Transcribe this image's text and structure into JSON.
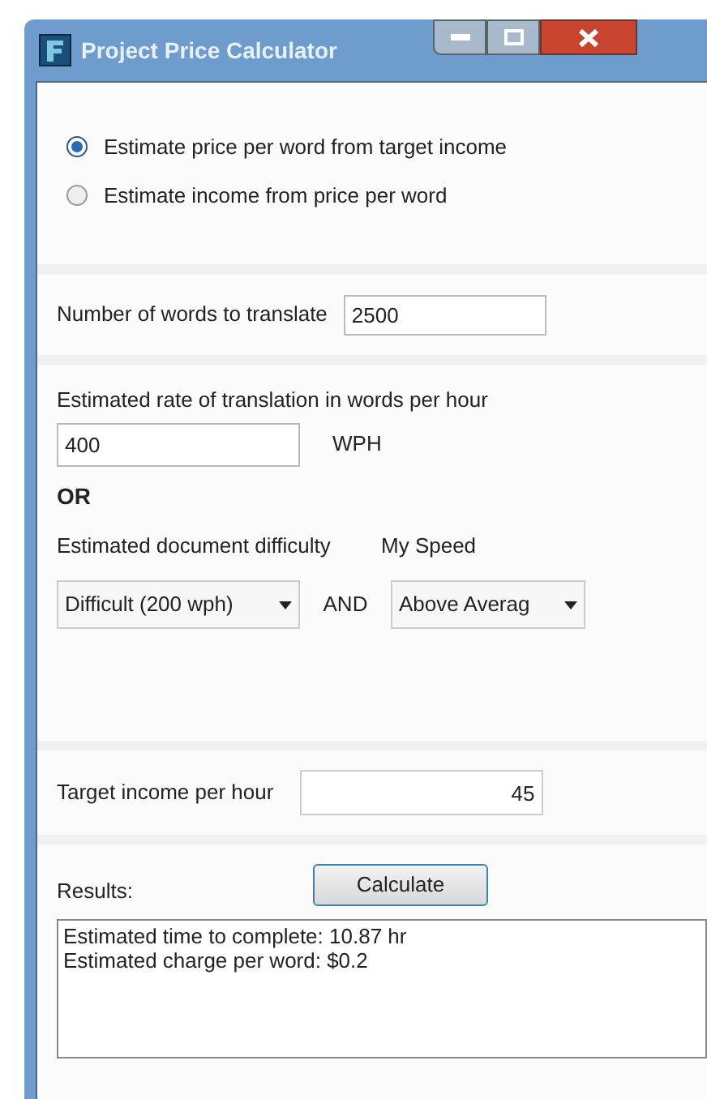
{
  "window": {
    "title": "Project Price Calculator"
  },
  "modes": [
    {
      "label": "Estimate price per word from target income",
      "selected": true
    },
    {
      "label": "Estimate income from price per word",
      "selected": false
    }
  ],
  "words": {
    "label": "Number of words to translate",
    "value": "2500"
  },
  "rate": {
    "label": "Estimated rate of translation in words per hour",
    "value": "400",
    "unit": "WPH"
  },
  "or_label": "OR",
  "difficulty": {
    "label": "Estimated document difficulty",
    "value": "Difficult (200 wph)"
  },
  "and_label": "AND",
  "speed": {
    "label": "My Speed",
    "value": "Above Averag"
  },
  "target": {
    "label": "Target income per hour",
    "value": "45"
  },
  "results": {
    "label": "Results:",
    "lines": [
      "Estimated time to complete: 10.87 hr",
      "Estimated charge per word: $0.2"
    ]
  },
  "calculate_button": "Calculate"
}
